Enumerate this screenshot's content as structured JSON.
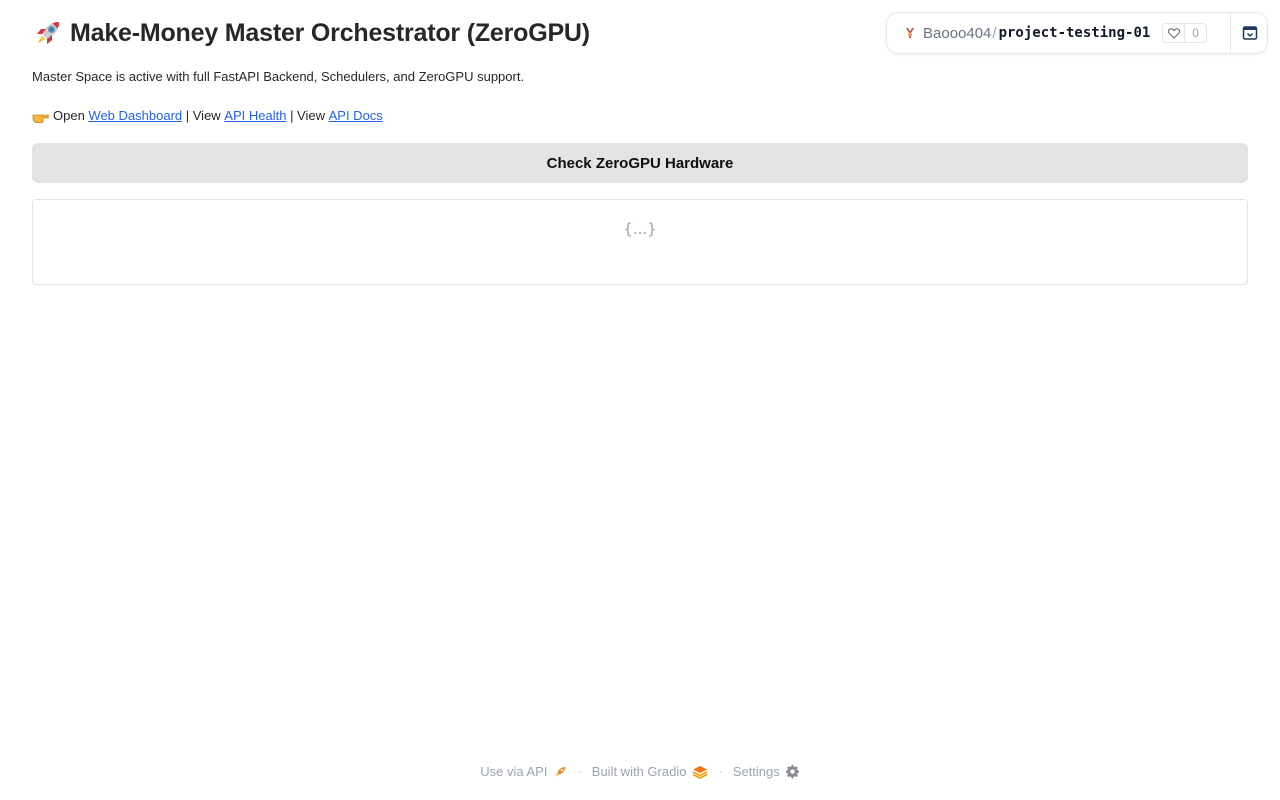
{
  "header": {
    "title": "Make-Money Master Orchestrator (ZeroGPU)",
    "title_icon": "rocket-icon"
  },
  "description": "Master Space is active with full FastAPI Backend, Schedulers, and ZeroGPU support.",
  "links_line": {
    "icon": "pointing-hand-icon",
    "open_text": "Open ",
    "web_dashboard": "Web Dashboard",
    "sep1": " | View ",
    "api_health": "API Health",
    "sep2": " | View ",
    "api_docs": "API Docs"
  },
  "check_button": {
    "label": "Check ZeroGPU Hardware"
  },
  "json_output": {
    "placeholder": "{...}"
  },
  "space_badge": {
    "owner": "Baooo404",
    "separator": "/",
    "repo": "project-testing-01",
    "likes": "0"
  },
  "footer": {
    "use_api": "Use via API",
    "built_with": "Built with Gradio",
    "settings": "Settings",
    "separator": "·"
  },
  "colors": {
    "link": "#2563eb",
    "button_bg": "#e4e4e7",
    "gradio_orange": "#f97316"
  }
}
